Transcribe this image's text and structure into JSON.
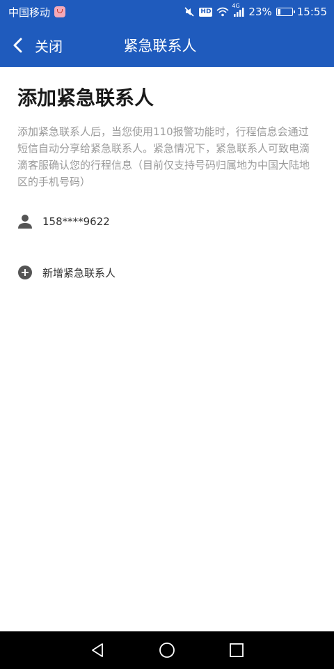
{
  "status_bar": {
    "carrier": "中国移动",
    "hd_label": "HD",
    "network": "4G",
    "battery_percent": "23%",
    "battery_level": 0.23,
    "time": "15:55"
  },
  "app_bar": {
    "back_label": "关闭",
    "title": "紧急联系人"
  },
  "main": {
    "title": "添加紧急联系人",
    "description": "添加紧急联系人后，当您使用110报警功能时，行程信息会通过短信自动分享给紧急联系人。紧急情况下，紧急联系人可致电滴滴客服确认您的行程信息（目前仅支持号码归属地为中国大陆地区的手机号码）",
    "contacts": [
      {
        "phone": "158****9622"
      }
    ],
    "add_contact_label": "新增紧急联系人"
  },
  "colors": {
    "primary": "#1f5bbd",
    "text_dark": "#1a1a1a",
    "text_gray": "#9a9a9a",
    "icon_gray": "#555555"
  }
}
